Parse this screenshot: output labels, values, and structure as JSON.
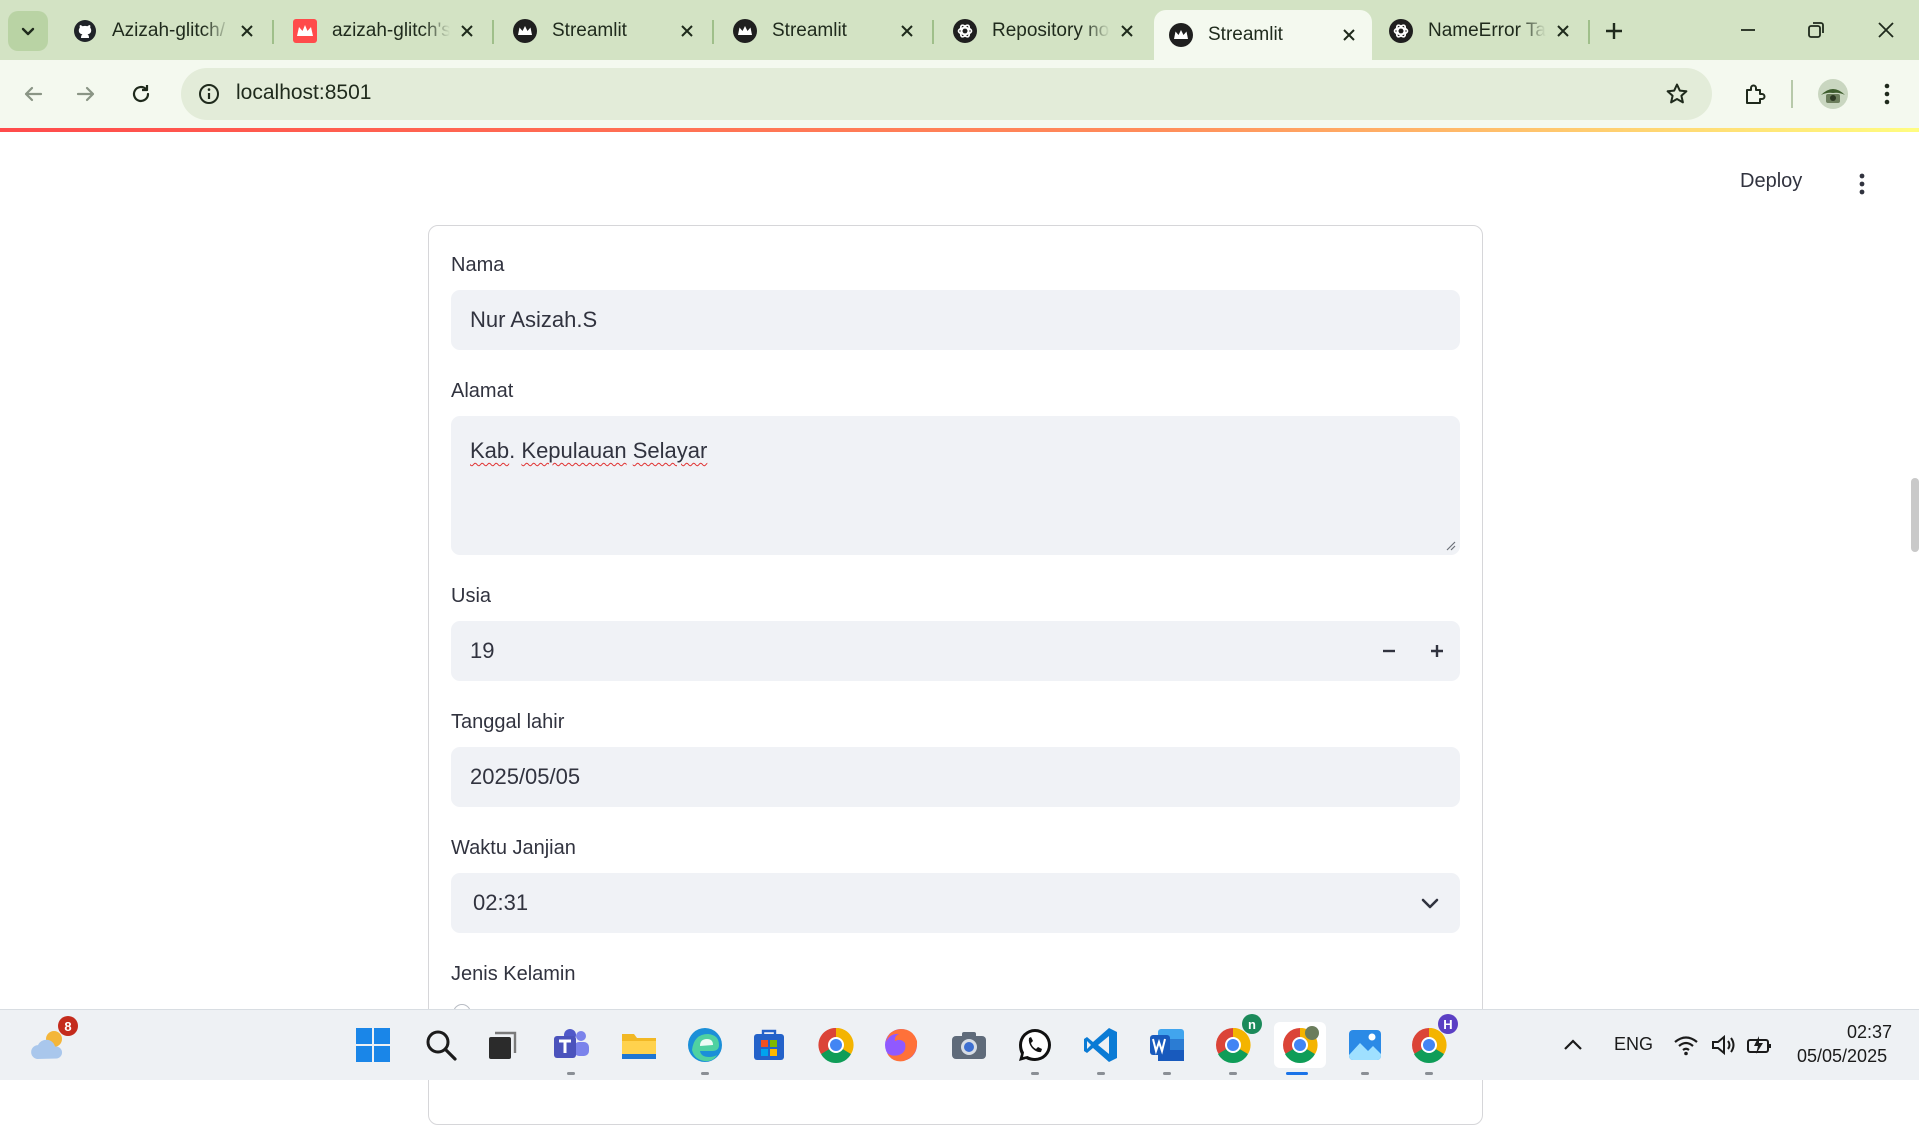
{
  "browser": {
    "tabs": [
      {
        "title": "Azizah-glitch/",
        "icon": "github-icon",
        "active": false
      },
      {
        "title": "azizah-glitch's",
        "icon": "streamlit-red-icon",
        "active": false
      },
      {
        "title": "Streamlit",
        "icon": "streamlit-crown-icon",
        "active": false
      },
      {
        "title": "Streamlit",
        "icon": "streamlit-crown-icon",
        "active": false
      },
      {
        "title": "Repository no",
        "icon": "openai-icon",
        "active": false
      },
      {
        "title": "Streamlit",
        "icon": "streamlit-crown-icon",
        "active": true
      },
      {
        "title": "NameError Ta",
        "icon": "openai-icon",
        "active": false
      }
    ],
    "address": "localhost:8501",
    "colors": {
      "frame": "#d3e3c4",
      "toolbar": "#f4f9ef",
      "omnibox": "#e3ecd9"
    }
  },
  "app": {
    "deploy_label": "Deploy",
    "fields": {
      "nama": {
        "label": "Nama",
        "value": "Nur Asizah.S"
      },
      "alamat": {
        "label": "Alamat",
        "value_parts": [
          "Kab",
          ". ",
          "Kepulauan",
          " ",
          "Selayar"
        ]
      },
      "usia": {
        "label": "Usia",
        "value": "19"
      },
      "tanggal_lahir": {
        "label": "Tanggal lahir",
        "value": "2025/05/05"
      },
      "waktu_janjian": {
        "label": "Waktu Janjian",
        "value": "02:31"
      },
      "jenis_kelamin": {
        "label": "Jenis Kelamin"
      }
    },
    "colors": {
      "field_bg": "#f0f2f6",
      "text": "#31333f",
      "accent": "#ff4b4b"
    }
  },
  "taskbar": {
    "weather_badge": "8",
    "icons": [
      "weather-icon",
      "windows-start-icon",
      "search-icon",
      "task-view-icon",
      "teams-icon",
      "file-explorer-icon",
      "edge-icon",
      "microsoft-store-icon",
      "chrome-icon",
      "firefox-icon",
      "camera-icon",
      "whatsapp-icon",
      "vscode-icon",
      "word-icon",
      "chrome-profile-n-icon",
      "chrome-profile-active-icon",
      "photos-icon",
      "chrome-profile-h-icon"
    ],
    "chrome_n_badge": "n",
    "chrome_h_badge": "H",
    "language": "ENG",
    "time": "02:37",
    "date": "05/05/2025"
  }
}
